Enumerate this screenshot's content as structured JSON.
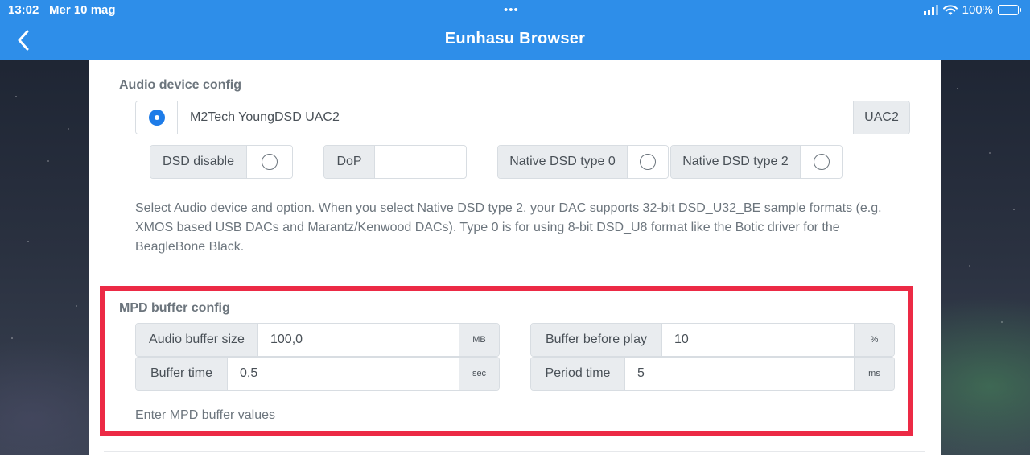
{
  "status_bar": {
    "time": "13:02",
    "date": "Mer 10 mag",
    "dots": "•••",
    "battery": "100%"
  },
  "nav": {
    "title": "Eunhasu Browser"
  },
  "audio_device": {
    "title": "Audio device config",
    "device_name": "M2Tech YoungDSD UAC2",
    "device_tag": "UAC2",
    "device_selected": true,
    "options": [
      {
        "label": "DSD disable",
        "selected": false
      },
      {
        "label": "DoP",
        "selected": true
      },
      {
        "label": "Native DSD type 0",
        "selected": false
      },
      {
        "label": "Native DSD type 2",
        "selected": false
      }
    ],
    "help_lines": [
      "Select Audio device and option. When you select Native DSD type 2, your DAC supports 32-bit DSD_U32_BE sample formats (e.g.",
      "XMOS based USB DACs and Marantz/Kenwood DACs). Type 0 is for using 8-bit DSD_U8 format like the Botic driver for the",
      "BeagleBone Black."
    ]
  },
  "mpd_buffer": {
    "title": "MPD buffer config",
    "audio_buffer_size": {
      "label": "Audio buffer size",
      "value": "100,0",
      "unit": "MB"
    },
    "buffer_before_play": {
      "label": "Buffer before play",
      "value": "10",
      "unit": "%"
    },
    "buffer_time": {
      "label": "Buffer time",
      "value": "0,5",
      "unit": "sec"
    },
    "period_time": {
      "label": "Period time",
      "value": "5",
      "unit": "ms"
    },
    "help": "Enter MPD buffer values"
  },
  "colors": {
    "accent": "#2e8ee9",
    "radio_on": "#1e7ce8",
    "highlight": "#ec2a45"
  }
}
